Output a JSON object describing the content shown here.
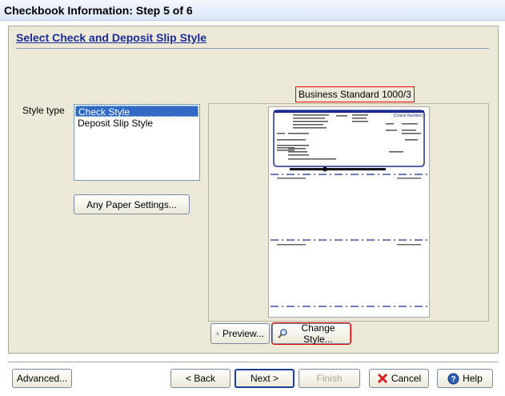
{
  "window": {
    "title": "Checkbook Information: Step 5 of 6"
  },
  "section": {
    "heading": "Select Check and Deposit Slip Style"
  },
  "style_type": {
    "label": "Style type",
    "options": [
      "Check Style",
      "Deposit Slip Style"
    ],
    "selected": "Check Style"
  },
  "paper_settings": {
    "label": "Any Paper Settings..."
  },
  "preview": {
    "style_name": "Business Standard 1000/3",
    "check_number_label": "[Check Number]"
  },
  "actions": {
    "preview": "Preview...",
    "change_style": "Change Style..."
  },
  "footer": {
    "advanced": "Advanced...",
    "back": "< Back",
    "next": "Next >",
    "finish": "Finish",
    "cancel": "Cancel",
    "help": "Help"
  },
  "colors": {
    "heading": "#1a2b9a",
    "selection": "#316ac5",
    "highlight_box": "#e00000",
    "cancel_x": "#d42020",
    "help": "#2a5db0"
  },
  "icons": {
    "preview": "magnifier-page-icon",
    "change_style": "magnifier-icon",
    "cancel": "red-x-icon",
    "help": "help-circle-icon"
  }
}
